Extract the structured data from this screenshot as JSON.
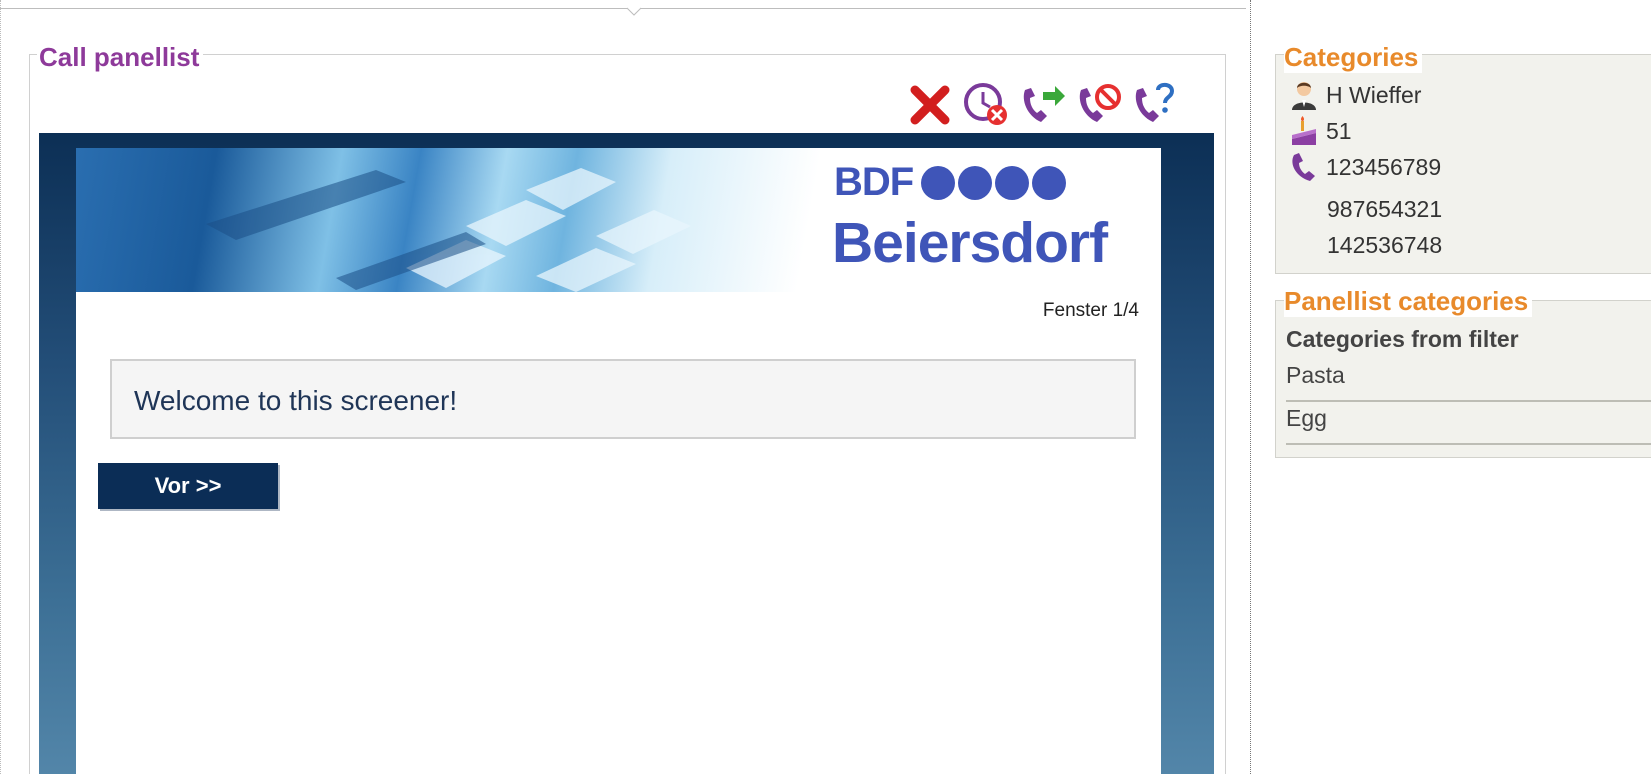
{
  "call_panel": {
    "title": "Call panellist",
    "actions": [
      {
        "icon": "close-icon",
        "color": "#d21f1f"
      },
      {
        "icon": "clock-cancel-icon",
        "color": "#7a3a9a"
      },
      {
        "icon": "phone-forward-icon",
        "color": "#7a3a9a"
      },
      {
        "icon": "phone-block-icon",
        "color": "#7a3a9a"
      },
      {
        "icon": "phone-help-icon",
        "color": "#7a3a9a"
      }
    ]
  },
  "screener": {
    "brand_short": "BDF",
    "brand_name": "Beiersdorf",
    "page_indicator": "Fenster 1/4",
    "welcome_text": "Welcome to this screener!",
    "next_label": "Vor >>",
    "brand_color": "#3f55b8",
    "frame_color": "#0b2d56"
  },
  "categories": {
    "title": "Categories",
    "name": "H Wieffer",
    "age": "51",
    "phones": [
      "123456789",
      "987654321",
      "142536748"
    ]
  },
  "panellist_categories": {
    "title": "Panellist categories",
    "subtitle": "Categories from filter",
    "items": [
      "Pasta",
      "Egg"
    ]
  },
  "colors": {
    "legend_purple": "#8e3a9a",
    "legend_orange": "#e88a2b"
  }
}
